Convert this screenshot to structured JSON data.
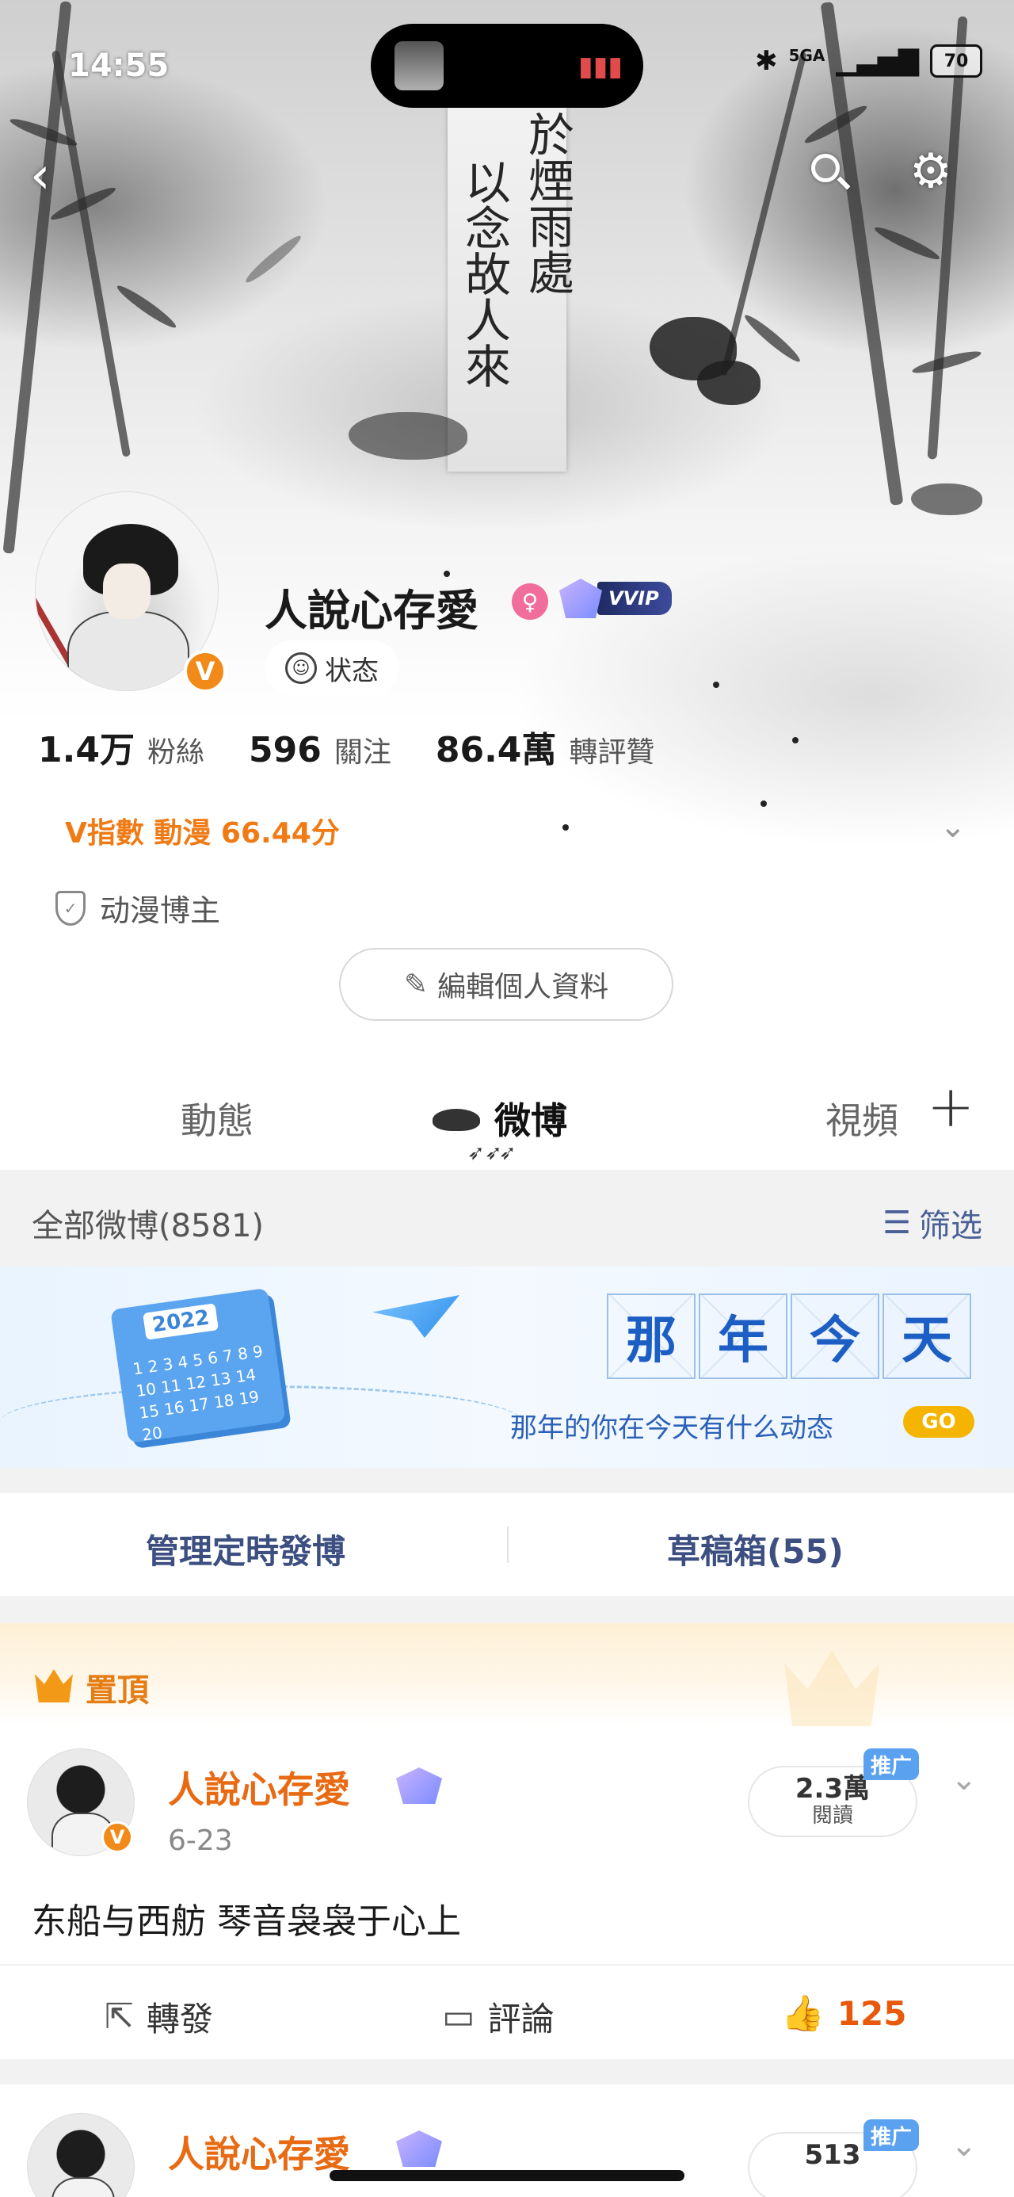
{
  "status_bar": {
    "time": "14:55",
    "network": "5GA",
    "battery": "70"
  },
  "header": {
    "calligraphy_line1": "於煙雨處",
    "calligraphy_line2": "以念故人來"
  },
  "profile": {
    "username": "人說心存愛",
    "vvip_label": "VVIP",
    "status_label": "状态",
    "stats": [
      {
        "value": "1.4万",
        "label": "粉絲"
      },
      {
        "value": "596",
        "label": "關注"
      },
      {
        "value": "86.4萬",
        "label": "轉評贊"
      }
    ],
    "v_index": "V指數 動漫 66.44分",
    "category": "动漫博主",
    "edit_button": "編輯個人資料"
  },
  "tabs": {
    "items": [
      "動態",
      "微博",
      "視頻"
    ],
    "active": "微博"
  },
  "filter": {
    "count_label": "全部微博(8581)",
    "filter_label": "筛选"
  },
  "banner": {
    "year": "2022",
    "calendar_numbers": "1 2 3 4 5 6 7 8 9 10 11 12 13 14 15 16 17 18 19 20",
    "title_chars": [
      "那",
      "年",
      "今",
      "天"
    ],
    "subtitle": "那年的你在今天有什么动态",
    "go_label": "GO"
  },
  "manage": {
    "scheduled": "管理定時發博",
    "drafts": "草稿箱(55)"
  },
  "pinned": {
    "label": "置頂"
  },
  "posts": [
    {
      "username": "人說心存愛",
      "date": "6-23",
      "reads_value": "2.3萬",
      "reads_label": "閱讀",
      "promo": "推广",
      "text": "东船与西舫 琴音袅袅于心上",
      "repost_label": "轉發",
      "comment_label": "評論",
      "likes": "125"
    },
    {
      "username": "人說心存愛",
      "reads_value": "513",
      "promo": "推广"
    }
  ],
  "colors": {
    "accent_orange": "#f07b15",
    "link_blue": "#4a6096",
    "vip_purple": "#7b8cff"
  }
}
